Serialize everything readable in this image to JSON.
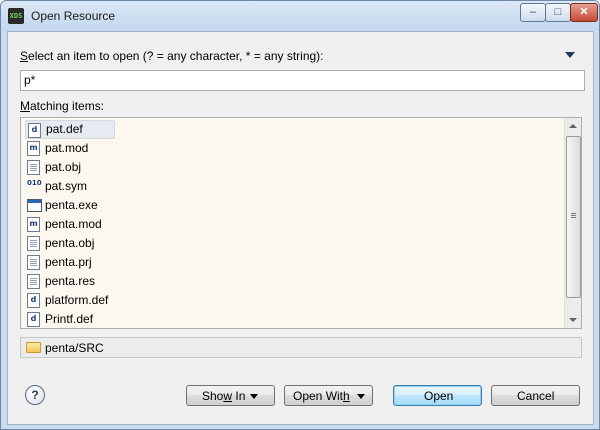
{
  "titlebar": {
    "icon_text": "XDS",
    "title": "Open Resource",
    "minimize": "–",
    "maximize": "□",
    "close": "✕"
  },
  "prompt": {
    "label_accel": "S",
    "label_rest": "elect an item to open (? = any character, * = any string):"
  },
  "search": {
    "value": "p*",
    "placeholder": ""
  },
  "matching": {
    "label_accel": "M",
    "label_rest": "atching items:"
  },
  "items": [
    {
      "name": "pat.def",
      "icon": "def-file-icon",
      "glyph": "d",
      "selected": true
    },
    {
      "name": "pat.mod",
      "icon": "mod-file-icon",
      "glyph": "m",
      "selected": false
    },
    {
      "name": "pat.obj",
      "icon": "obj-file-icon",
      "glyph": "",
      "selected": false
    },
    {
      "name": "pat.sym",
      "icon": "sym-file-icon",
      "glyph": "010",
      "selected": false
    },
    {
      "name": "penta.exe",
      "icon": "exe-file-icon",
      "glyph": "",
      "selected": false
    },
    {
      "name": "penta.mod",
      "icon": "mod-file-icon",
      "glyph": "m",
      "selected": false
    },
    {
      "name": "penta.obj",
      "icon": "obj-file-icon",
      "glyph": "",
      "selected": false
    },
    {
      "name": "penta.prj",
      "icon": "prj-file-icon",
      "glyph": "",
      "selected": false
    },
    {
      "name": "penta.res",
      "icon": "res-file-icon",
      "glyph": "",
      "selected": false
    },
    {
      "name": "platform.def",
      "icon": "def-file-icon",
      "glyph": "d",
      "selected": false
    },
    {
      "name": "Printf.def",
      "icon": "def-file-icon",
      "glyph": "d",
      "selected": false
    }
  ],
  "status": {
    "path": "penta/SRC"
  },
  "buttons": {
    "help": "?",
    "show_in_pre": "Sho",
    "show_in_accel": "w",
    "show_in_post": " In",
    "open_with_pre": "Open Wit",
    "open_with_accel": "h",
    "open_with_post": "",
    "open": "Open",
    "cancel": "Cancel"
  },
  "colors": {
    "list_background": "#fcf8f0",
    "dialog_background": "#f0f0f0",
    "primary_button": "#bee6fd"
  }
}
